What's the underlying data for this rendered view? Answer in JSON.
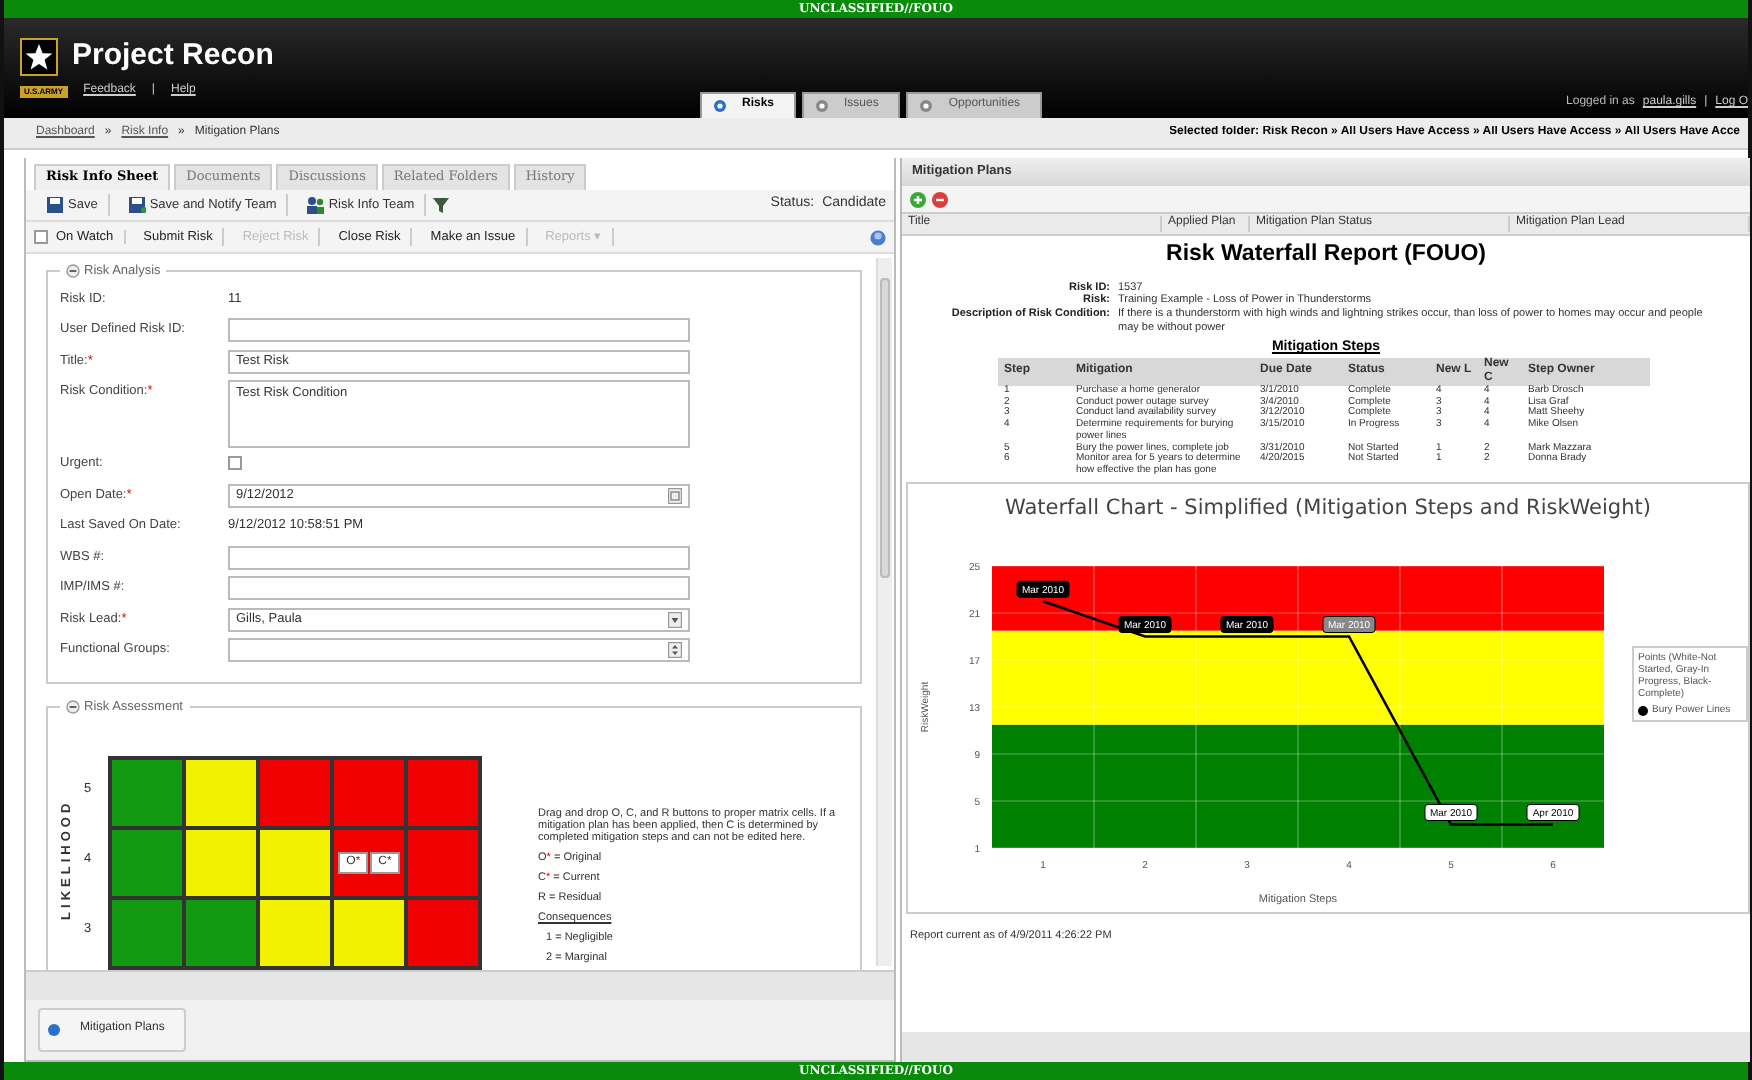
{
  "classification_top": "UNCLASSIFIED//FOUO",
  "header": {
    "logo_caption": "U.S.ARMY",
    "title": "Project Recon",
    "links": [
      "Feedback",
      "Help"
    ],
    "separator": "|",
    "tabs": [
      {
        "label": "Risks",
        "selected": true
      },
      {
        "label": "Issues",
        "selected": false
      },
      {
        "label": "Opportunities",
        "selected": false
      }
    ],
    "login_prefix": "Logged in as",
    "user": "paula.gills",
    "login_separator": "|",
    "logout": "Log O"
  },
  "breadcrumb": {
    "items": [
      "Dashboard",
      "Risk Info",
      "Mitigation Plans"
    ],
    "separator": "»",
    "selected_folder": "Selected folder: Risk Recon » All Users Have Access » All Users Have Access » All Users Have Acce"
  },
  "left_panel": {
    "tabs": [
      {
        "label": "Risk Info Sheet",
        "selected": true
      },
      {
        "label": "Documents",
        "selected": false
      },
      {
        "label": "Discussions",
        "selected": false
      },
      {
        "label": "Related Folders",
        "selected": false
      },
      {
        "label": "History",
        "selected": false
      }
    ],
    "toolbar": [
      {
        "kind": "save",
        "label": "Save"
      },
      {
        "kind": "save-notify",
        "label": "Save and Notify Team"
      },
      {
        "kind": "team",
        "label": "Risk Info Team"
      },
      {
        "kind": "filter"
      }
    ],
    "status_label": "Status:",
    "status": "Candidate",
    "actions": [
      {
        "kind": "checkbox",
        "label": "On Watch",
        "checked": false,
        "disabled": false
      },
      {
        "kind": "button",
        "label": "Submit Risk",
        "disabled": false
      },
      {
        "kind": "button",
        "label": "Reject Risk",
        "disabled": true
      },
      {
        "kind": "button",
        "label": "Close Risk",
        "disabled": false
      },
      {
        "kind": "button",
        "label": "Make an Issue",
        "disabled": false
      },
      {
        "kind": "menu",
        "label": "Reports",
        "caret": "▾",
        "disabled": true
      }
    ],
    "risk_analysis": {
      "legend": "Risk Analysis",
      "fields": [
        {
          "label": "Risk ID:",
          "kind": "static",
          "value": "11"
        },
        {
          "label": "User Defined Risk ID:",
          "kind": "input"
        },
        {
          "label": "Title:",
          "required_mark": "*",
          "kind": "input",
          "value": "Test Risk"
        },
        {
          "label": "Risk Condition:",
          "required_mark": "*",
          "kind": "textarea",
          "value": "Test Risk Condition"
        },
        {
          "label": "Urgent:",
          "kind": "checkbox",
          "checked": false
        },
        {
          "label": "Open Date:",
          "required_mark": "*",
          "kind": "date",
          "value": "9/12/2012"
        },
        {
          "label": "Last Saved On Date:",
          "kind": "static",
          "value": "9/12/2012 10:58:51 PM"
        },
        {
          "label": "WBS #:",
          "kind": "input"
        },
        {
          "label": "IMP/IMS #:",
          "kind": "input"
        },
        {
          "label": "Risk Lead:",
          "required_mark": "*",
          "kind": "select",
          "value": "Gills, Paula"
        },
        {
          "label": "Functional Groups:",
          "kind": "multiselect"
        }
      ]
    },
    "risk_assessment": {
      "legend": "Risk Assessment",
      "axis_label": "LIKELIHOOD",
      "rows": [
        {
          "label": "5",
          "cells": [
            {
              "color": "#139a13"
            },
            {
              "color": "#f2f200"
            },
            {
              "color": "#f00000"
            },
            {
              "color": "#f00000"
            },
            {
              "color": "#f00000"
            }
          ]
        },
        {
          "label": "4",
          "cells": [
            {
              "color": "#139a13"
            },
            {
              "color": "#f2f200"
            },
            {
              "color": "#f2f200"
            },
            {
              "color": "#f00000",
              "markers": [
                {
                  "letter": "O",
                  "mark": "*"
                },
                {
                  "letter": "C",
                  "mark": "*"
                }
              ]
            },
            {
              "color": "#f00000"
            }
          ]
        },
        {
          "label": "3",
          "cells": [
            {
              "color": "#139a13"
            },
            {
              "color": "#139a13"
            },
            {
              "color": "#f2f200"
            },
            {
              "color": "#f2f200"
            },
            {
              "color": "#f00000"
            }
          ]
        }
      ],
      "help_text": "Drag and drop O, C, and R buttons to proper matrix cells. If a mitigation plan has been applied, then C is determined by completed mitigation steps and can not be edited here.",
      "key": [
        {
          "symbol": "O",
          "mark": "*",
          "text": "= Original"
        },
        {
          "symbol": "C",
          "mark": "*",
          "text": "= Current"
        },
        {
          "symbol": "R",
          "text": "= Residual"
        }
      ],
      "consequences_title": "Consequences",
      "consequences": [
        "1 = Negligible",
        "2 = Marginal"
      ]
    },
    "bottom_button": "Mitigation Plans"
  },
  "right_panel": {
    "title": "Mitigation Plans",
    "columns": [
      "Title",
      "Applied Plan",
      "Mitigation Plan Status",
      "Mitigation Plan Lead"
    ],
    "report": {
      "title": "Risk Waterfall Report (FOUO)",
      "info": [
        {
          "label": "Risk ID:",
          "value": "1537"
        },
        {
          "label": "Risk:",
          "value": "Training Example - Loss of Power in Thunderstorms"
        },
        {
          "label": "Description of Risk Condition:",
          "value": "If there is a thunderstorm with high winds and lightning strikes occur, than loss of power to homes may occur and people may be without power"
        }
      ],
      "steps_title": "Mitigation Steps",
      "steps_columns": [
        "Step",
        "Mitigation",
        "Due Date",
        "Status",
        "New L",
        "New C",
        "Step Owner"
      ],
      "steps": [
        [
          "1",
          "Purchase a home generator",
          "3/1/2010",
          "Complete",
          "4",
          "4",
          "Barb Drosch"
        ],
        [
          "2",
          "Conduct power outage survey",
          "3/4/2010",
          "Complete",
          "3",
          "4",
          "Lisa Graf"
        ],
        [
          "3",
          "Conduct land availability survey",
          "3/12/2010",
          "Complete",
          "3",
          "4",
          "Matt Sheehy"
        ],
        [
          "4",
          "Determine requirements for burying power lines",
          "3/15/2010",
          "In Progress",
          "3",
          "4",
          "Mike Olsen"
        ],
        [
          "5",
          "Bury the power lines, complete job",
          "3/31/2010",
          "Not Started",
          "1",
          "2",
          "Mark Mazzara"
        ],
        [
          "6",
          "Monitor area for 5 years to determine how effective the plan has gone",
          "4/20/2015",
          "Not Started",
          "1",
          "2",
          "Donna Brady"
        ]
      ],
      "legend_title": "Points (White-Not Started, Gray-In Progress, Black-Complete)",
      "chart_data": {
        "type": "line",
        "title": "Waterfall Chart - Simplified (Mitigation Steps and RiskWeight)",
        "xlabel": "Mitigation Steps",
        "ylabel": "RiskWeight",
        "x": [
          1,
          2,
          3,
          4,
          5,
          6
        ],
        "xlim": [
          0.5,
          6.5
        ],
        "grid": true,
        "series": [
          {
            "name": "Bury Power Lines",
            "color": "#000000",
            "values": [
              22,
              19,
              19,
              19,
              3,
              3
            ]
          }
        ],
        "ylim": [
          1,
          25
        ],
        "yticks": [
          1,
          5,
          9,
          13,
          17,
          21,
          25
        ],
        "xticks": [
          1,
          2,
          3,
          4,
          5,
          6
        ],
        "annotations": [
          {
            "x": 1,
            "y": 22,
            "text": "Mar 2010"
          },
          {
            "x": 2,
            "y": 19,
            "text": "Mar 2010"
          },
          {
            "x": 3,
            "y": 19,
            "text": "Mar 2010"
          },
          {
            "x": 4,
            "y": 19,
            "text": "Mar 2010"
          },
          {
            "x": 5,
            "y": 3,
            "text": "Mar 2010"
          },
          {
            "x": 6,
            "y": 3,
            "text": "Apr 2010"
          }
        ]
      },
      "risk_zones": [
        {
          "color": "#008000"
        },
        {
          "color": "#ffff00"
        },
        {
          "color": "#ff0000"
        }
      ],
      "point_labels": [
        {
          "color": "#000000"
        },
        {
          "color": "#000000"
        },
        {
          "color": "#000000"
        },
        {
          "color": "#888888"
        },
        {
          "color": "#ffffff"
        },
        {
          "color": "#ffffff"
        }
      ],
      "footer": "Report current as of 4/9/2011 4:26:22 PM"
    }
  },
  "classification_bottom": "UNCLASSIFIED//FOUO"
}
